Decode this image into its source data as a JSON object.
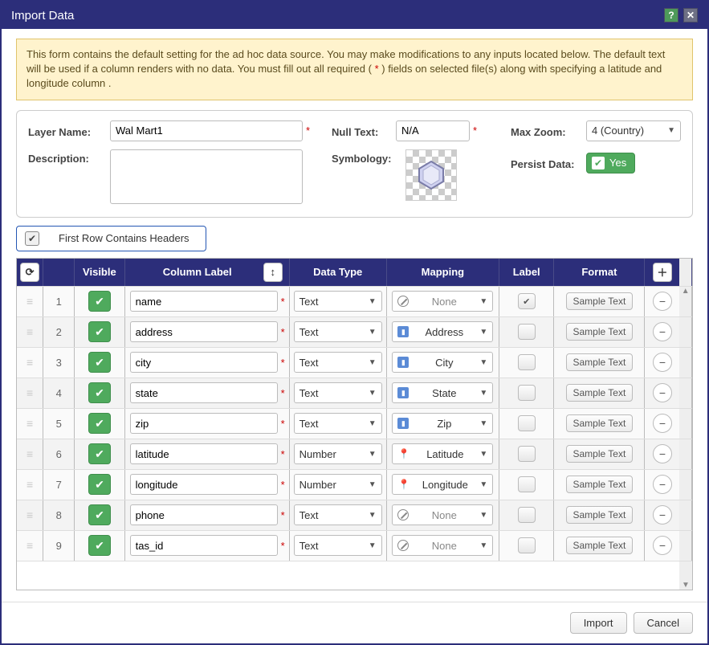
{
  "title": "Import Data",
  "info": {
    "t1": "This form contains the default setting for the ad hoc data source. You may make modifications to any inputs located below. The default text will be used if a column renders with no data. You must fill out all required (",
    "star": " * ",
    "t2": ") fields on selected file(s) along with specifying a latitude and longitude column ."
  },
  "form": {
    "layer_name_label": "Layer Name:",
    "layer_name_value": "Wal Mart1",
    "description_label": "Description:",
    "description_value": "",
    "null_text_label": "Null Text:",
    "null_text_value": "N/A",
    "symbology_label": "Symbology:",
    "max_zoom_label": "Max Zoom:",
    "max_zoom_value": "4 (Country)",
    "persist_label": "Persist Data:",
    "persist_value": "Yes"
  },
  "first_row_label": "First Row Contains Headers",
  "grid": {
    "head": {
      "visible": "Visible",
      "column_label": "Column Label",
      "data_type": "Data Type",
      "mapping": "Mapping",
      "label": "Label",
      "format": "Format"
    },
    "rows": [
      {
        "idx": "1",
        "label": "name",
        "type": "Text",
        "map": "None",
        "map_icon": "none",
        "label_checked": true,
        "fmt": "Sample Text"
      },
      {
        "idx": "2",
        "label": "address",
        "type": "Text",
        "map": "Address",
        "map_icon": "tag",
        "label_checked": false,
        "fmt": "Sample Text"
      },
      {
        "idx": "3",
        "label": "city",
        "type": "Text",
        "map": "City",
        "map_icon": "tag",
        "label_checked": false,
        "fmt": "Sample Text"
      },
      {
        "idx": "4",
        "label": "state",
        "type": "Text",
        "map": "State",
        "map_icon": "tag",
        "label_checked": false,
        "fmt": "Sample Text"
      },
      {
        "idx": "5",
        "label": "zip",
        "type": "Text",
        "map": "Zip",
        "map_icon": "tag",
        "label_checked": false,
        "fmt": "Sample Text"
      },
      {
        "idx": "6",
        "label": "latitude",
        "type": "Number",
        "map": "Latitude",
        "map_icon": "pin",
        "label_checked": false,
        "fmt": "Sample Text"
      },
      {
        "idx": "7",
        "label": "longitude",
        "type": "Number",
        "map": "Longitude",
        "map_icon": "pin",
        "label_checked": false,
        "fmt": "Sample Text"
      },
      {
        "idx": "8",
        "label": "phone",
        "type": "Text",
        "map": "None",
        "map_icon": "none",
        "label_checked": false,
        "fmt": "Sample Text"
      },
      {
        "idx": "9",
        "label": "tas_id",
        "type": "Text",
        "map": "None",
        "map_icon": "none",
        "label_checked": false,
        "fmt": "Sample Text"
      }
    ]
  },
  "footer": {
    "import": "Import",
    "cancel": "Cancel"
  }
}
